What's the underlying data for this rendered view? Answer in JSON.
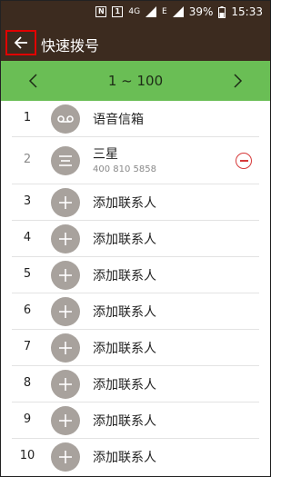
{
  "status_bar": {
    "icon_nfc": "N",
    "icon_sim": "1",
    "network": "4G",
    "signal_label": "E",
    "battery_percent": "39%",
    "time": "15:33"
  },
  "app_bar": {
    "back_icon": "arrow-left-icon",
    "title": "快速拨号"
  },
  "range_bar": {
    "label": "1 ~ 100",
    "prev_icon": "chevron-left-icon",
    "next_icon": "chevron-right-icon",
    "bg_color": "#6abe55"
  },
  "rows": [
    {
      "number": "1",
      "name": "语音信箱",
      "icon": "voicemail-icon"
    },
    {
      "number": "2",
      "name": "三星",
      "phone": "400 810 5858",
      "icon": "contact-avatar-icon",
      "removable": true
    },
    {
      "number": "3",
      "name": "添加联系人",
      "icon": "plus-icon"
    },
    {
      "number": "4",
      "name": "添加联系人",
      "icon": "plus-icon"
    },
    {
      "number": "5",
      "name": "添加联系人",
      "icon": "plus-icon"
    },
    {
      "number": "6",
      "name": "添加联系人",
      "icon": "plus-icon"
    },
    {
      "number": "7",
      "name": "添加联系人",
      "icon": "plus-icon"
    },
    {
      "number": "8",
      "name": "添加联系人",
      "icon": "plus-icon"
    },
    {
      "number": "9",
      "name": "添加联系人",
      "icon": "plus-icon"
    },
    {
      "number": "10",
      "name": "添加联系人",
      "icon": "plus-icon"
    }
  ],
  "colors": {
    "header_bg": "#3c2b1f",
    "avatar_bg": "#a8a29d",
    "remove_red": "#d63a3a"
  }
}
